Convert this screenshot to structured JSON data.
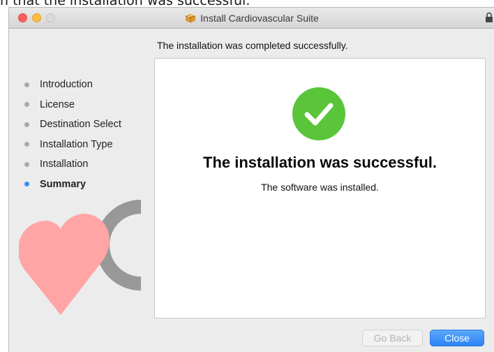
{
  "caption": "n that the installation was successful.",
  "window": {
    "title": "Install Cardiovascular Suite"
  },
  "header": {
    "message": "The installation was completed successfully."
  },
  "steps": [
    {
      "label": "Introduction",
      "active": false
    },
    {
      "label": "License",
      "active": false
    },
    {
      "label": "Destination Select",
      "active": false
    },
    {
      "label": "Installation Type",
      "active": false
    },
    {
      "label": "Installation",
      "active": false
    },
    {
      "label": "Summary",
      "active": true
    }
  ],
  "content": {
    "title": "The installation was successful.",
    "subtitle": "The software was installed."
  },
  "buttons": {
    "back": "Go Back",
    "close": "Close"
  },
  "colors": {
    "accent": "#2c84f6",
    "success": "#5ac53b",
    "heart": "#ffa5a5"
  },
  "icons": [
    "package-icon",
    "lock-icon",
    "checkmark-icon",
    "heart-icon"
  ]
}
